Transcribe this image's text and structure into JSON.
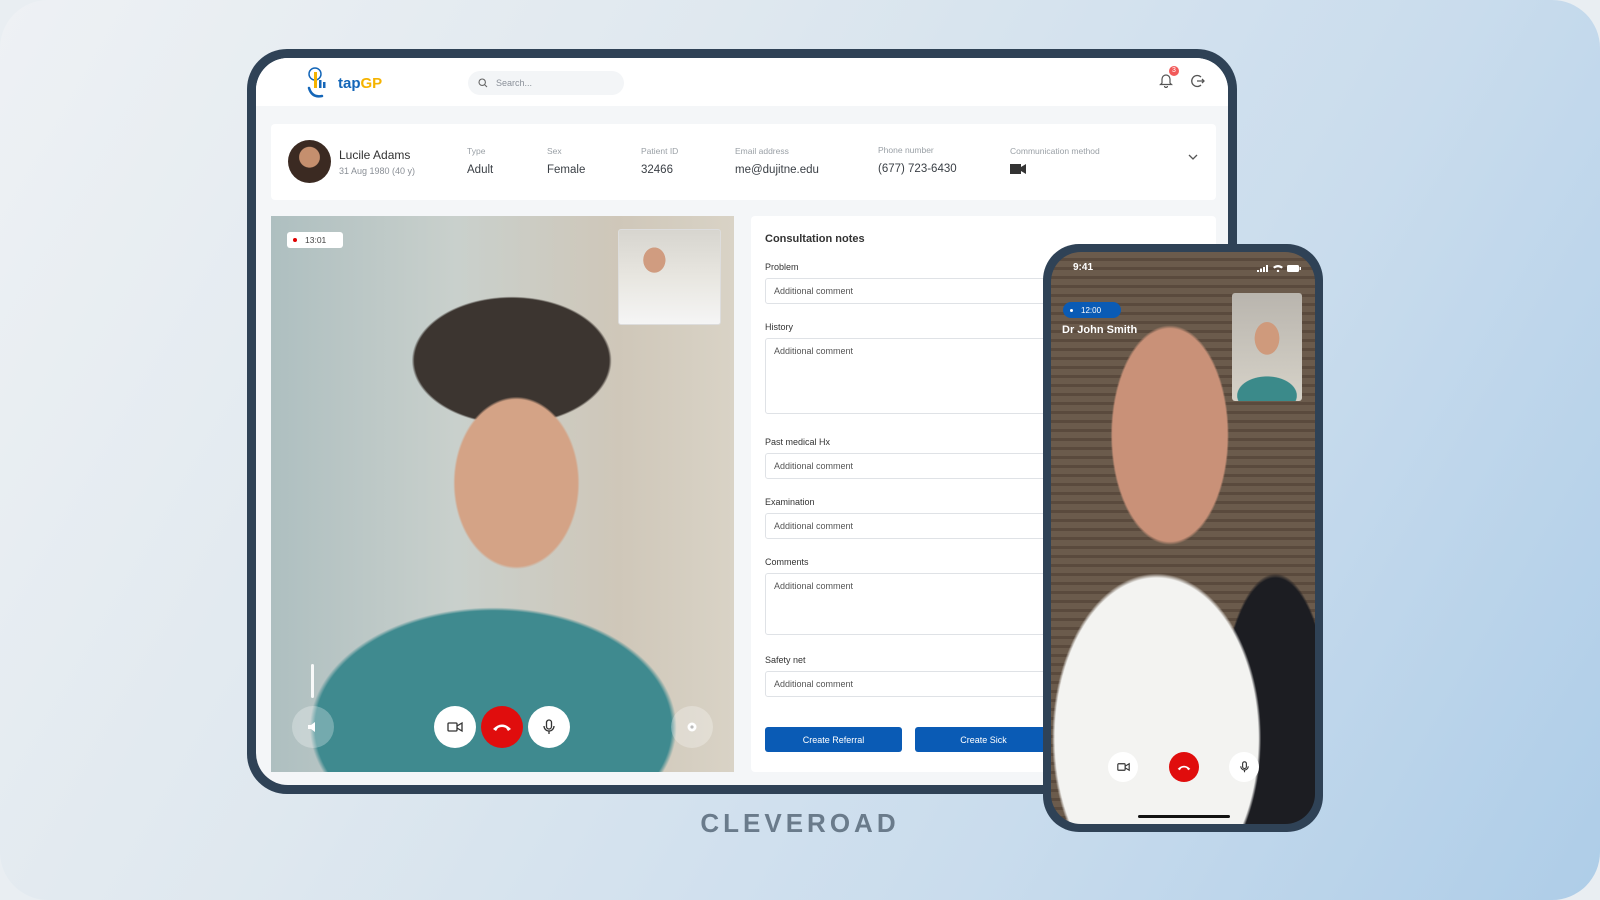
{
  "app": {
    "logo_prefix": "tap",
    "logo_suffix": "GP",
    "search_placeholder": "Search...",
    "notification_count": "3"
  },
  "patient": {
    "name": "Lucile Adams",
    "dob": "31 Aug 1980 (40 y)",
    "fields": [
      {
        "label": "Type",
        "value": "Adult"
      },
      {
        "label": "Sex",
        "value": "Female"
      },
      {
        "label": "Patient ID",
        "value": "32466"
      },
      {
        "label": "Email address",
        "value": "me@dujitne.edu"
      },
      {
        "label": "Phone number",
        "value": "(677) 723-6430"
      },
      {
        "label": "Communication method",
        "value_icon": "video-camera-icon"
      }
    ]
  },
  "video_call": {
    "timer": "13:01",
    "controls": [
      "volume-icon",
      "video-camera-icon",
      "hang-up-icon",
      "microphone-icon",
      "settings-icon"
    ]
  },
  "consultation": {
    "title": "Consultation notes",
    "fields": [
      {
        "label": "Problem",
        "placeholder": "Additional comment"
      },
      {
        "label": "History",
        "placeholder": "Additional comment"
      },
      {
        "label": "Past medical Hx",
        "placeholder": "Additional comment"
      },
      {
        "label": "Examination",
        "placeholder": "Additional comment"
      },
      {
        "label": "Comments",
        "placeholder": "Additional comment"
      },
      {
        "label": "Safety net",
        "placeholder": "Additional comment"
      }
    ],
    "buttons": {
      "referral": "Create Referral",
      "sick": "Create Sick"
    }
  },
  "phone": {
    "status_time": "9:41",
    "call_timer": "12:00",
    "caller_name": "Dr John Smith"
  },
  "brand": "CLEVEROAD",
  "colors": {
    "primary": "#0a5bb5",
    "danger": "#e00d0d",
    "logo_yellow": "#f5b300",
    "frame": "#2f4256"
  }
}
